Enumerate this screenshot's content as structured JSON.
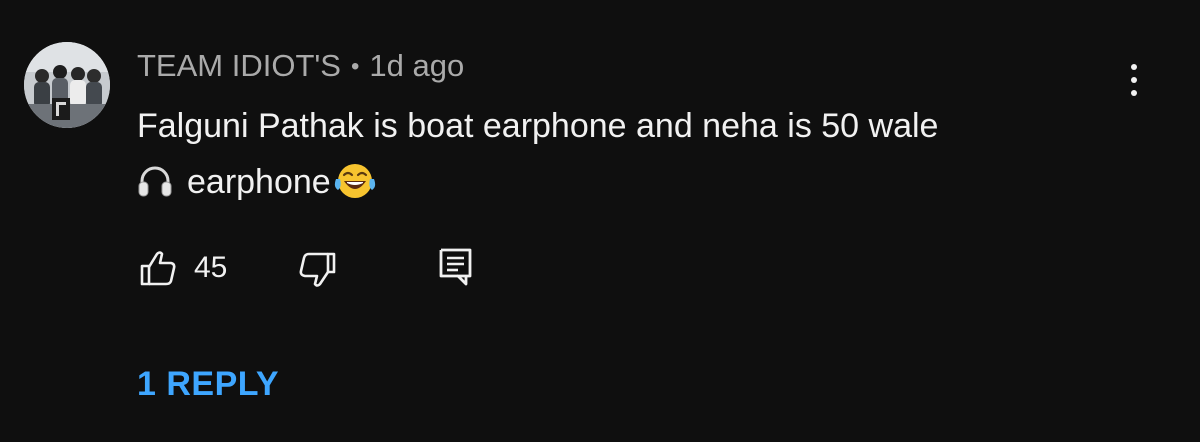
{
  "comment": {
    "author": "TEAM IDIOT'S",
    "separator": "•",
    "timestamp": "1d ago",
    "text_line1": "Falguni Pathak is boat earphone and neha is 50 wale",
    "text_line2": "earphone",
    "emoji_icons": [
      "headphones-emoji-icon",
      "laughing-tears-emoji-icon"
    ]
  },
  "actions": {
    "like_count": "45",
    "icons": [
      "thumbs-up-icon",
      "thumbs-down-icon",
      "reply-icon",
      "more-vertical-icon"
    ]
  },
  "replies": {
    "label": "1 REPLY"
  },
  "colors": {
    "background": "#0f0f0f",
    "text": "#f1f1f1",
    "secondary_text": "#aaaaaa",
    "link": "#3ea6ff"
  }
}
